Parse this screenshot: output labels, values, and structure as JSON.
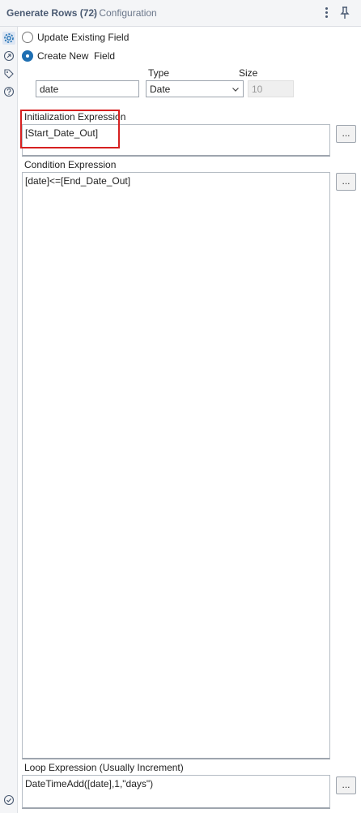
{
  "header": {
    "title": "Generate Rows (72)",
    "subtitle": "- Configuration",
    "more_icon": "vertical-dots-icon",
    "pin_icon": "pin-icon"
  },
  "sidebar": {
    "icons": [
      "gear-icon",
      "navigate-arrow-icon",
      "tag-icon",
      "help-icon",
      "checkmark-circle-icon"
    ]
  },
  "field_mode": {
    "options": [
      {
        "label": "Update Existing Field",
        "selected": false
      },
      {
        "label": "Create New  Field",
        "selected": true
      }
    ]
  },
  "new_field": {
    "name_value": "date",
    "type_label": "Type",
    "type_value": "Date",
    "size_label": "Size",
    "size_value": "10"
  },
  "initialization": {
    "label": "Initialization Expression",
    "value": "[Start_Date_Out]",
    "button": "..."
  },
  "condition": {
    "label": "Condition Expression",
    "value": "[date]<=[End_Date_Out]",
    "button": "..."
  },
  "loop": {
    "label": "Loop Expression (Usually Increment)",
    "value": "DateTimeAdd([date],1,\"days\")",
    "button": "..."
  },
  "colors": {
    "accent": "#1f6fb2",
    "highlight_border": "#d62020",
    "header_text": "#4a5a72"
  }
}
